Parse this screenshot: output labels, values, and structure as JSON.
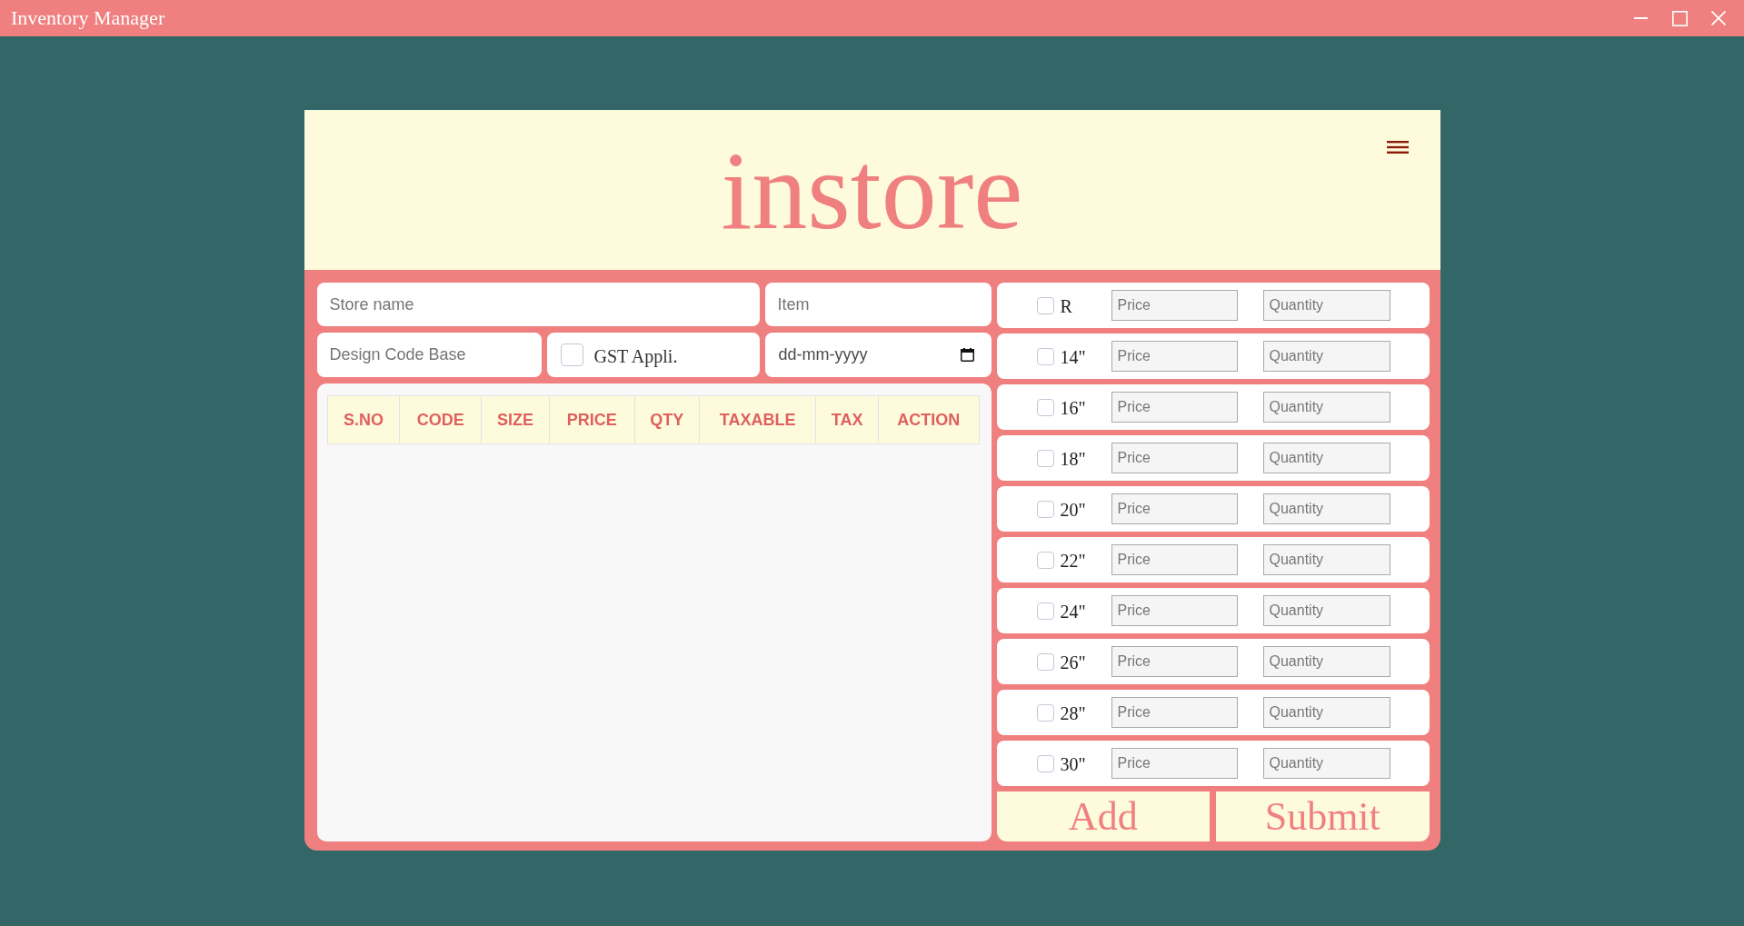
{
  "window": {
    "title": "Inventory Manager"
  },
  "header": {
    "logo": "instore"
  },
  "form": {
    "store_name": {
      "placeholder": "Store name"
    },
    "item": {
      "placeholder": "Item"
    },
    "design_code_base": {
      "placeholder": "Design Code Base"
    },
    "gst": {
      "label": "GST Appli.",
      "checked": false
    },
    "date": {
      "placeholder": "dd-mm-yyyy"
    }
  },
  "table": {
    "columns": [
      "S.NO",
      "CODE",
      "SIZE",
      "PRICE",
      "QTY",
      "TAXABLE",
      "TAX",
      "ACTION"
    ]
  },
  "sizes": [
    {
      "label": "R",
      "checked": false,
      "price": {
        "placeholder": "Price"
      },
      "quantity": {
        "placeholder": "Quantity"
      }
    },
    {
      "label": "14\"",
      "checked": false,
      "price": {
        "placeholder": "Price"
      },
      "quantity": {
        "placeholder": "Quantity"
      }
    },
    {
      "label": "16\"",
      "checked": false,
      "price": {
        "placeholder": "Price"
      },
      "quantity": {
        "placeholder": "Quantity"
      }
    },
    {
      "label": "18\"",
      "checked": false,
      "price": {
        "placeholder": "Price"
      },
      "quantity": {
        "placeholder": "Quantity"
      }
    },
    {
      "label": "20\"",
      "checked": false,
      "price": {
        "placeholder": "Price"
      },
      "quantity": {
        "placeholder": "Quantity"
      }
    },
    {
      "label": "22\"",
      "checked": false,
      "price": {
        "placeholder": "Price"
      },
      "quantity": {
        "placeholder": "Quantity"
      }
    },
    {
      "label": "24\"",
      "checked": false,
      "price": {
        "placeholder": "Price"
      },
      "quantity": {
        "placeholder": "Quantity"
      }
    },
    {
      "label": "26\"",
      "checked": false,
      "price": {
        "placeholder": "Price"
      },
      "quantity": {
        "placeholder": "Quantity"
      }
    },
    {
      "label": "28\"",
      "checked": false,
      "price": {
        "placeholder": "Price"
      },
      "quantity": {
        "placeholder": "Quantity"
      }
    },
    {
      "label": "30\"",
      "checked": false,
      "price": {
        "placeholder": "Price"
      },
      "quantity": {
        "placeholder": "Quantity"
      }
    }
  ],
  "buttons": [
    "Add",
    "Submit"
  ]
}
